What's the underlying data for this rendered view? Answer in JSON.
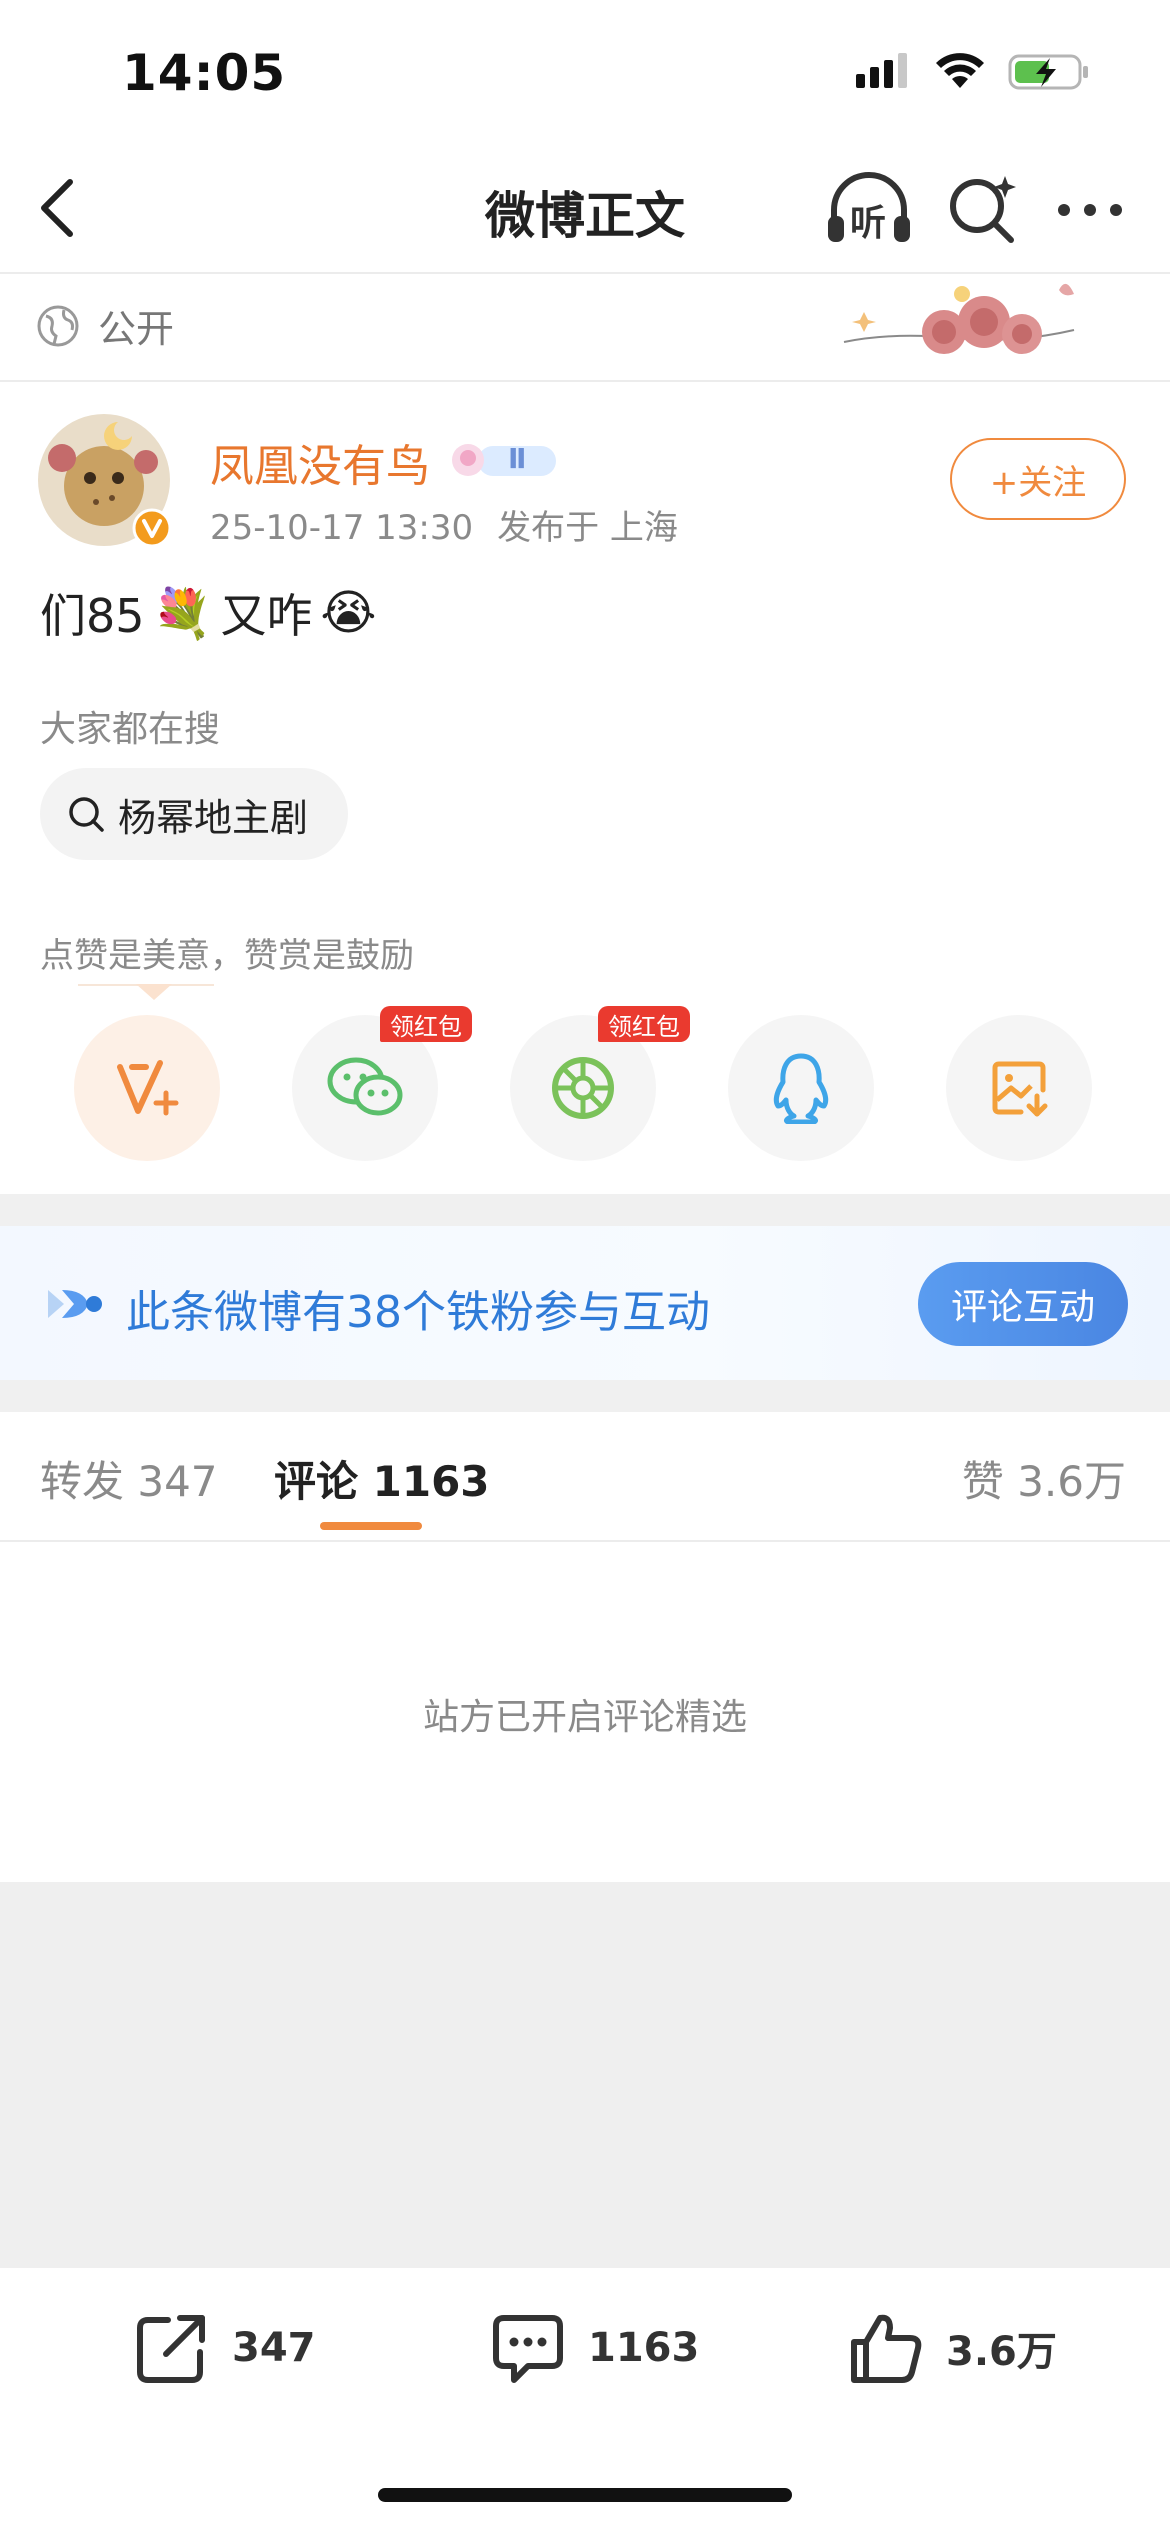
{
  "status_bar": {
    "time": "14:05"
  },
  "nav": {
    "title": "微博正文",
    "listen_label": "听"
  },
  "visibility": {
    "label": "公开"
  },
  "author": {
    "name": "凤凰没有鸟",
    "time": "25-10-17 13:30",
    "location": "发布于 上海",
    "follow_label": "+关注",
    "level_badge": "Ⅱ"
  },
  "post": {
    "text_before": "们85",
    "emoji_flowers": "💐",
    "text_after": "又咋",
    "emoji_cry": "😭"
  },
  "hot_search": {
    "label": "大家都在搜",
    "query": "杨幂地主剧"
  },
  "reward": {
    "text": "点赞是美意，赞赏是鼓励",
    "badge_wechat": "领红包",
    "badge_moments": "领红包"
  },
  "fans_banner": {
    "text": "此条微博有38个铁粉参与互动",
    "button": "评论互动"
  },
  "tabs": {
    "repost": "转发 347",
    "comments": "评论 1163",
    "likes": "赞 3.6万"
  },
  "comment_note": "站方已开启评论精选",
  "actions": {
    "repost_count": "347",
    "comment_count": "1163",
    "like_count": "3.6万"
  },
  "colors": {
    "accent_orange": "#f08a3e",
    "author_orange": "#e8772e",
    "link_blue": "#2f7bd8",
    "badge_red": "#ea3a2f"
  }
}
